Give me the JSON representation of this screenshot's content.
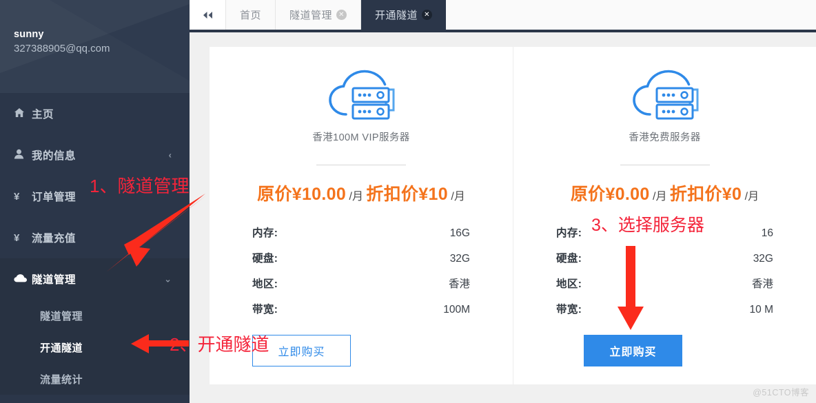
{
  "sidebar": {
    "user": {
      "name": "sunny",
      "email": "327388905@qq.com"
    },
    "items": [
      {
        "label": "主页",
        "icon": "home-icon",
        "glyph": "⌂",
        "chevron": ""
      },
      {
        "label": "我的信息",
        "icon": "user-icon",
        "glyph": "♟",
        "chevron": "‹"
      },
      {
        "label": "订单管理",
        "icon": "yuan-icon",
        "glyph": "¥",
        "chevron": ""
      },
      {
        "label": "流量充值",
        "icon": "yuan-icon",
        "glyph": "¥",
        "chevron": ""
      }
    ],
    "group": {
      "label": "隧道管理",
      "icon": "cloud-icon",
      "chevron": "⌄",
      "children": [
        {
          "label": "隧道管理",
          "active": false
        },
        {
          "label": "开通隧道",
          "active": true
        },
        {
          "label": "流量统计",
          "active": false
        }
      ]
    }
  },
  "tabbar": {
    "collapse_icon": "«",
    "tabs": [
      {
        "label": "首页",
        "closable": false,
        "close_glyph": "",
        "active": false
      },
      {
        "label": "隧道管理",
        "closable": true,
        "close_glyph": "✕",
        "active": false
      },
      {
        "label": "开通隧道",
        "closable": true,
        "close_glyph": "✕",
        "active": true
      }
    ]
  },
  "cards": [
    {
      "title": "香港100M VIP服务器",
      "icon": "cloud-server-icon",
      "price_original_label": "原价¥10.00",
      "price_original_unit": "/月",
      "price_discount_label": "折扣价¥10",
      "price_discount_unit": "/月",
      "specs": [
        {
          "key": "内存:",
          "value": "16G"
        },
        {
          "key": "硬盘:",
          "value": "32G"
        },
        {
          "key": "地区:",
          "value": "香港"
        },
        {
          "key": "带宽:",
          "value": "100M"
        }
      ],
      "buy_label": "立即购买",
      "buy_style": "outline"
    },
    {
      "title": "香港免费服务器",
      "icon": "cloud-server-icon",
      "price_original_label": "原价¥0.00",
      "price_original_unit": "/月",
      "price_discount_label": "折扣价¥0",
      "price_discount_unit": "/月",
      "specs": [
        {
          "key": "内存:",
          "value": "16"
        },
        {
          "key": "硬盘:",
          "value": "32G"
        },
        {
          "key": "地区:",
          "value": "香港"
        },
        {
          "key": "带宽:",
          "value": "10 M"
        }
      ],
      "buy_label": "立即购买",
      "buy_style": "filled"
    }
  ],
  "annotations": [
    {
      "text": "1、隧道管理",
      "arrow": "diagonal-down-left-arrow"
    },
    {
      "text": "2、开通隧道",
      "arrow": "left-arrow"
    },
    {
      "text": "3、选择服务器",
      "arrow": "down-arrow"
    }
  ],
  "watermark": "@51CTO博客",
  "colors": {
    "sidebar": "#2b3649",
    "accent_blue": "#2f8ae8",
    "price_orange": "#f4731c",
    "annotation_red": "#f4243a"
  }
}
